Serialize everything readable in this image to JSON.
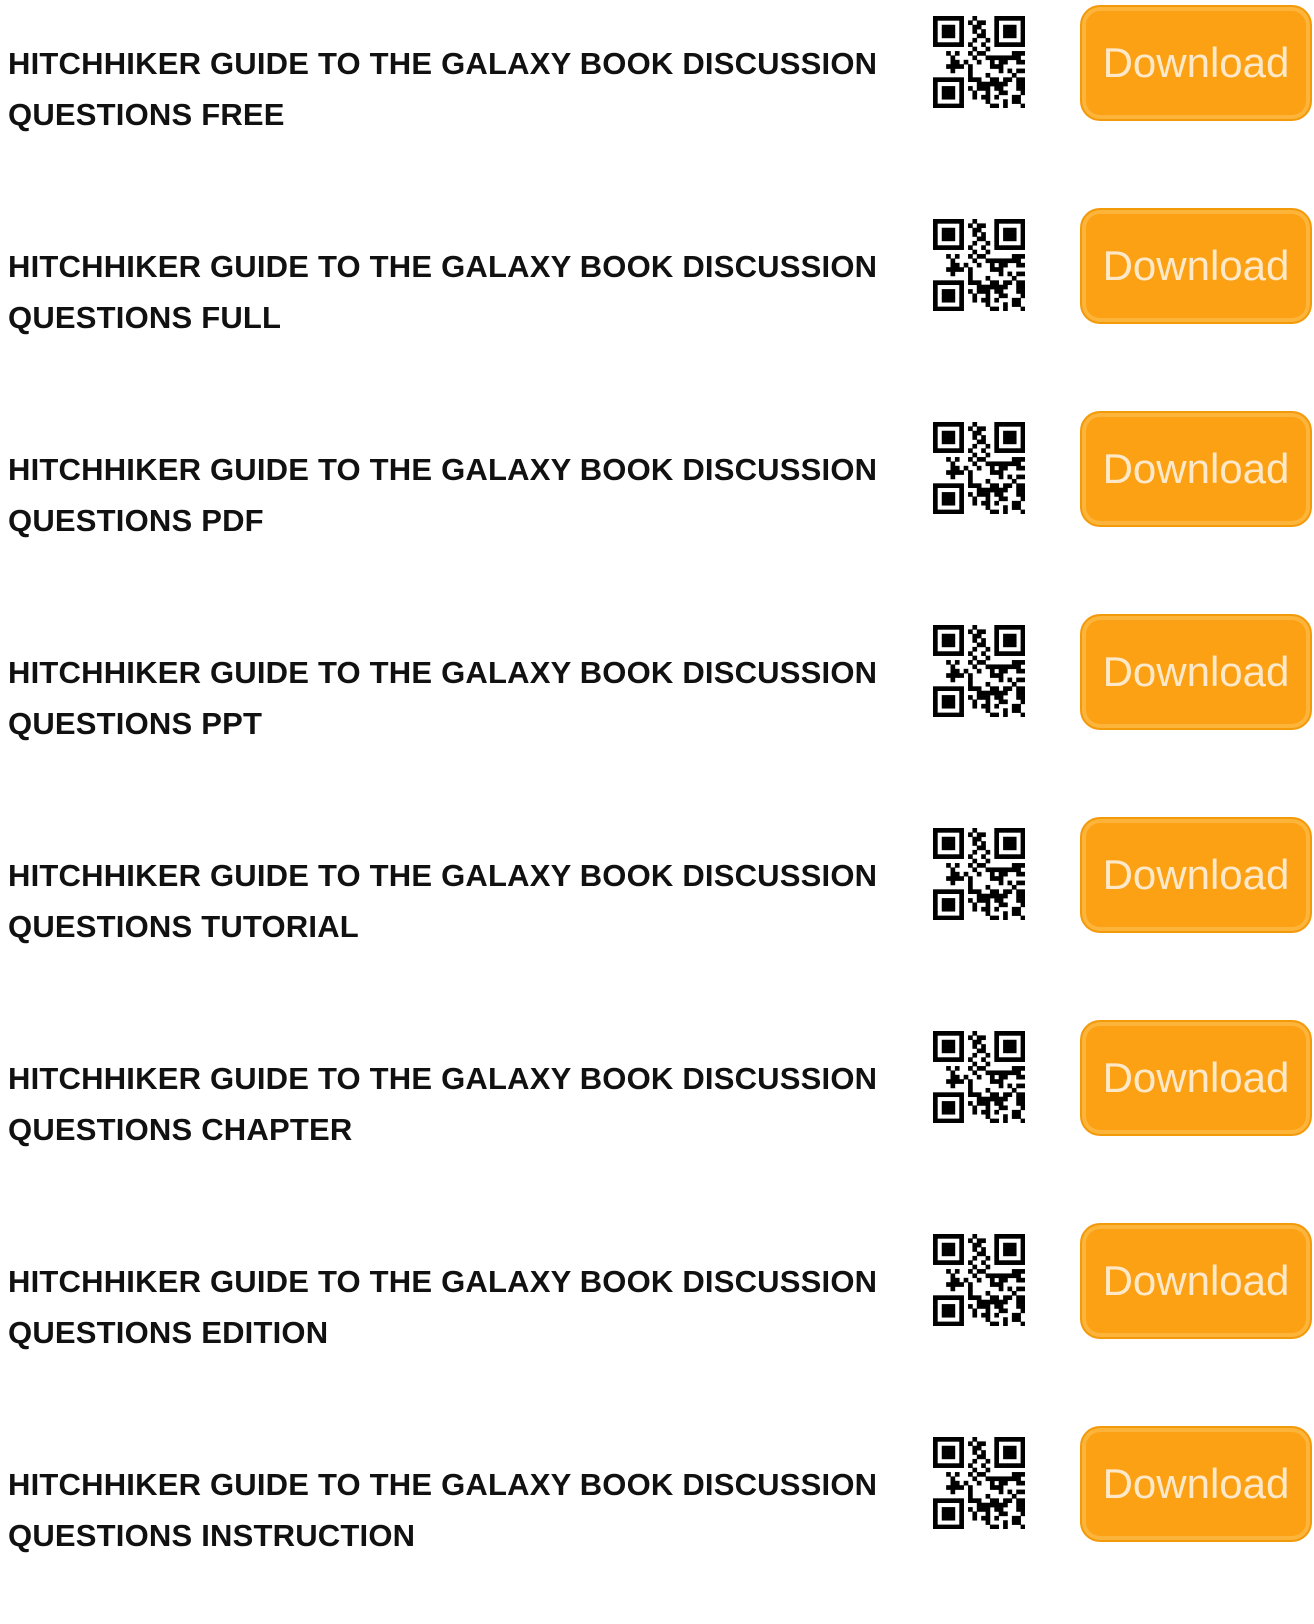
{
  "colors": {
    "button_fill": "#fca114",
    "button_border": "#f39a0b",
    "button_text": "#fde9c9",
    "title_text": "#111111"
  },
  "items": [
    {
      "title_line1": "HITCHHIKER GUIDE TO THE GALAXY BOOK DISCUSSION",
      "title_line2": "QUESTIONS FREE",
      "icon": "qr-code-icon",
      "button_label": "Download"
    },
    {
      "title_line1": "HITCHHIKER GUIDE TO THE GALAXY BOOK DISCUSSION",
      "title_line2": "QUESTIONS FULL",
      "icon": "qr-code-icon",
      "button_label": "Download"
    },
    {
      "title_line1": "HITCHHIKER GUIDE TO THE GALAXY BOOK DISCUSSION",
      "title_line2": "QUESTIONS PDF",
      "icon": "qr-code-icon",
      "button_label": "Download"
    },
    {
      "title_line1": "HITCHHIKER GUIDE TO THE GALAXY BOOK DISCUSSION",
      "title_line2": "QUESTIONS PPT",
      "icon": "qr-code-icon",
      "button_label": "Download"
    },
    {
      "title_line1": "HITCHHIKER GUIDE TO THE GALAXY BOOK DISCUSSION",
      "title_line2": "QUESTIONS TUTORIAL",
      "icon": "qr-code-icon",
      "button_label": "Download"
    },
    {
      "title_line1": "HITCHHIKER GUIDE TO THE GALAXY BOOK DISCUSSION",
      "title_line2": "QUESTIONS CHAPTER",
      "icon": "qr-code-icon",
      "button_label": "Download"
    },
    {
      "title_line1": "HITCHHIKER GUIDE TO THE GALAXY BOOK DISCUSSION",
      "title_line2": "QUESTIONS EDITION",
      "icon": "qr-code-icon",
      "button_label": "Download"
    },
    {
      "title_line1": "HITCHHIKER GUIDE TO THE GALAXY BOOK DISCUSSION",
      "title_line2": "QUESTIONS INSTRUCTION",
      "icon": "qr-code-icon",
      "button_label": "Download"
    }
  ]
}
